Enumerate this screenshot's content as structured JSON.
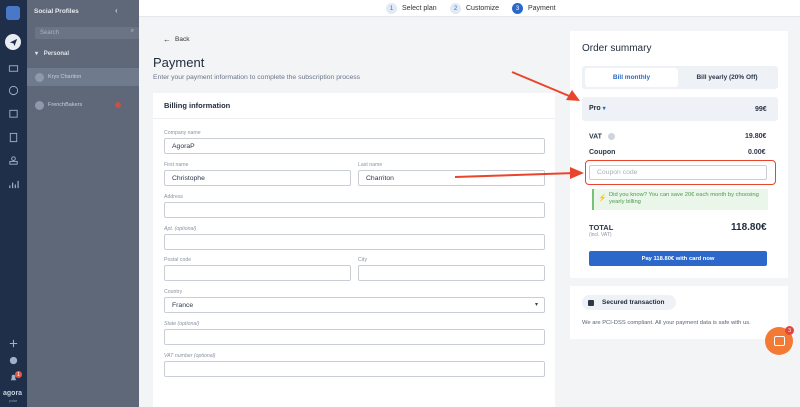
{
  "sidebar": {
    "title": "Social Profiles",
    "search_placeholder": "Search",
    "group_label": "Personal",
    "profiles": [
      {
        "name": "Krys Chariton"
      },
      {
        "name": "FrenchBakers"
      }
    ],
    "brand": "agora",
    "brand_sub": "pulse",
    "notification_count": "1"
  },
  "steps": [
    {
      "num": "1",
      "label": "Select plan"
    },
    {
      "num": "2",
      "label": "Customize"
    },
    {
      "num": "3",
      "label": "Payment"
    }
  ],
  "page": {
    "back_label": "Back",
    "title": "Payment",
    "subtitle": "Enter your payment information to complete the subscription process"
  },
  "billing": {
    "title": "Billing information",
    "company_label": "Company name",
    "company_value": "AgoraP",
    "first_name_label": "First name",
    "first_name_value": "Christophe",
    "last_name_label": "Last name",
    "last_name_value": "Charriton",
    "address_label": "Address",
    "apt_label": "Apt. (optional)",
    "postal_label": "Postal code",
    "city_label": "City",
    "country_label": "Country",
    "country_value": "France",
    "state_label": "State (optional)",
    "vat_label": "VAT number (optional)"
  },
  "summary": {
    "title": "Order summary",
    "bill_monthly": "Bill monthly",
    "bill_yearly": "Bill yearly (20% Off)",
    "plan_name": "Pro",
    "plan_price": "99€",
    "vat_label": "VAT",
    "vat_value": "19.80€",
    "coupon_label": "Coupon",
    "coupon_value": "0.00€",
    "coupon_placeholder": "Coupon code",
    "tip_text": "Did you know? You can save 20€ each month by choosing yearly billing",
    "total_label": "TOTAL",
    "total_sub": "(incl. VAT)",
    "total_value": "118.80€",
    "pay_button": "Pay 118.80€ with card now"
  },
  "secure": {
    "badge": "Secured transaction",
    "text": "We are PCI-DSS compliant. All your payment data is safe with us."
  },
  "chat": {
    "badge": "3"
  },
  "colors": {
    "accent": "#2b68c9",
    "annotation": "#e8452c",
    "tip_bg": "#eaf6ea",
    "tip_text": "#4b9a4b"
  }
}
